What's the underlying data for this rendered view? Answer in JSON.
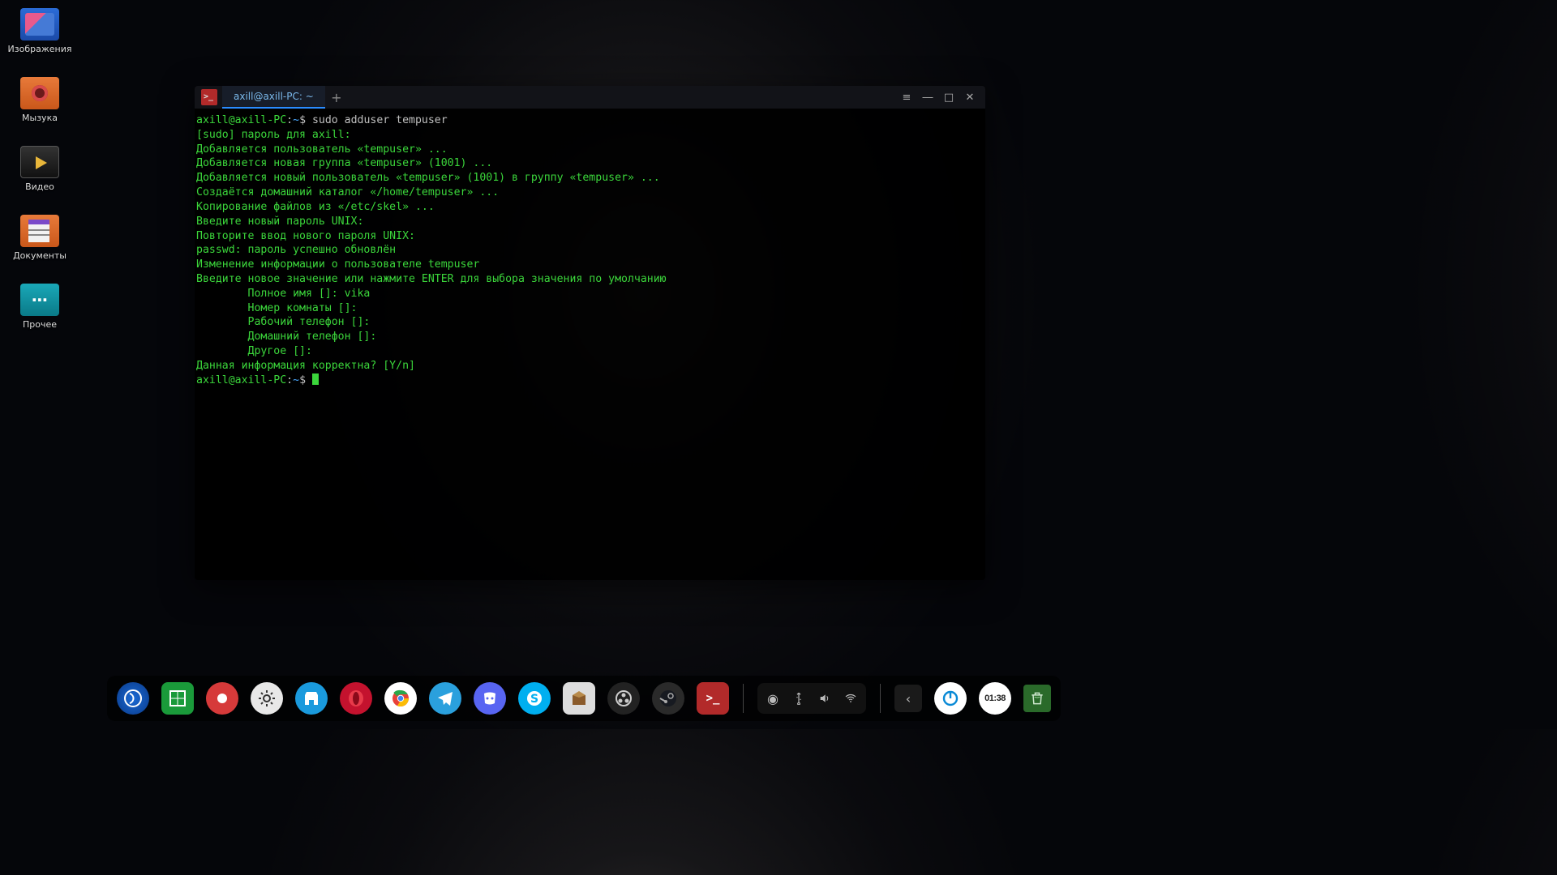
{
  "desktop": {
    "icons": [
      {
        "id": "pictures",
        "label": "Изображения"
      },
      {
        "id": "music",
        "label": "Мызука"
      },
      {
        "id": "video",
        "label": "Видео"
      },
      {
        "id": "docs",
        "label": "Документы"
      },
      {
        "id": "other",
        "label": "Прочее"
      }
    ]
  },
  "terminal": {
    "tab_title": "axill@axill-PC: ~",
    "prompt": {
      "user": "axill",
      "host": "axill-PC",
      "cwd": "~",
      "sep": ":",
      "end": "$"
    },
    "command": "sudo adduser tempuser",
    "lines": [
      "[sudo] пароль для axill:",
      "Добавляется пользователь «tempuser» ...",
      "Добавляется новая группа «tempuser» (1001) ...",
      "Добавляется новый пользователь «tempuser» (1001) в группу «tempuser» ...",
      "Создаётся домашний каталог «/home/tempuser» ...",
      "Копирование файлов из «/etc/skel» ...",
      "Введите новый пароль UNIX:",
      "Повторите ввод нового пароля UNIX:",
      "passwd: пароль успешно обновлён",
      "Изменение информации о пользователе tempuser",
      "Введите новое значение или нажмите ENTER для выбора значения по умолчанию",
      "        Полное имя []: vika",
      "        Номер комнаты []:",
      "        Рабочий телефон []:",
      "        Домашний телефон []:",
      "        Другое []:",
      "Данная информация корректна? [Y/n]"
    ]
  },
  "dock": {
    "clock": "01:38"
  },
  "colors": {
    "term_green": "#3bd63b",
    "term_path": "#4aa8ff",
    "accent": "#2a8cff"
  }
}
